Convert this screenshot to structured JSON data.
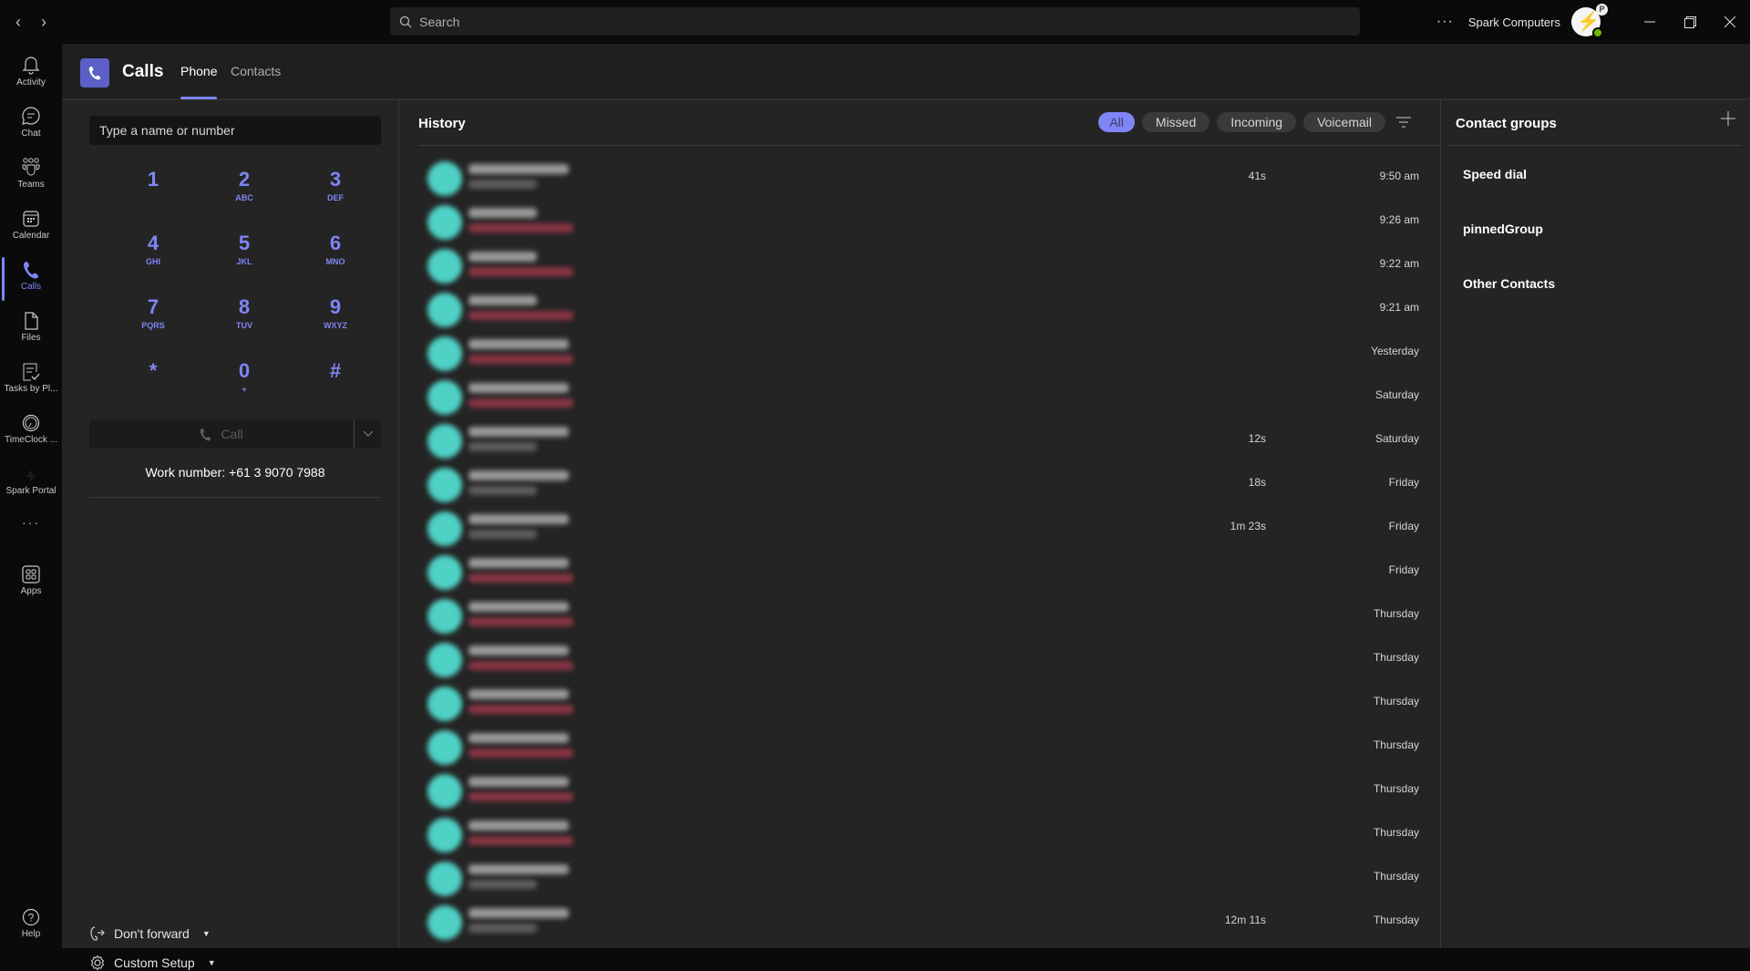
{
  "titlebar": {
    "search_placeholder": "Search",
    "more_label": "···",
    "org_name": "Spark Computers",
    "avatar_badge": "P",
    "icons": [
      "back-arrow-icon",
      "forward-arrow-icon",
      "search-icon",
      "more-icon",
      "minimize-icon",
      "restore-icon",
      "close-icon"
    ]
  },
  "rail": {
    "items": [
      {
        "label": "Activity",
        "icon": "bell-icon"
      },
      {
        "label": "Chat",
        "icon": "chat-icon"
      },
      {
        "label": "Teams",
        "icon": "teams-icon"
      },
      {
        "label": "Calendar",
        "icon": "calendar-icon"
      },
      {
        "label": "Calls",
        "icon": "phone-icon",
        "active": true
      },
      {
        "label": "Files",
        "icon": "file-icon"
      },
      {
        "label": "Tasks by Pl...",
        "icon": "tasks-icon"
      },
      {
        "label": "TimeClock ...",
        "icon": "clock-icon"
      },
      {
        "label": "Spark Portal",
        "icon": "bolt-icon"
      },
      {
        "label": "···",
        "icon": "more-apps-icon"
      },
      {
        "label": "Apps",
        "icon": "apps-icon"
      }
    ],
    "help_label": "Help"
  },
  "header": {
    "title": "Calls",
    "tabs": [
      {
        "label": "Phone",
        "active": true
      },
      {
        "label": "Contacts",
        "active": false
      }
    ]
  },
  "dialpad": {
    "input_placeholder": "Type a name or number",
    "keys": [
      {
        "digit": "1",
        "letters": ""
      },
      {
        "digit": "2",
        "letters": "ABC"
      },
      {
        "digit": "3",
        "letters": "DEF"
      },
      {
        "digit": "4",
        "letters": "GHI"
      },
      {
        "digit": "5",
        "letters": "JKL"
      },
      {
        "digit": "6",
        "letters": "MNO"
      },
      {
        "digit": "7",
        "letters": "PQRS"
      },
      {
        "digit": "8",
        "letters": "TUV"
      },
      {
        "digit": "9",
        "letters": "WXYZ"
      },
      {
        "digit": "*",
        "letters": ""
      },
      {
        "digit": "0",
        "letters": "+"
      },
      {
        "digit": "#",
        "letters": ""
      }
    ],
    "call_label": "Call",
    "work_number": "Work number: +61 3 9070 7988",
    "forward_label": "Don't forward",
    "setup_label": "Custom Setup"
  },
  "history": {
    "title": "History",
    "filters": [
      {
        "label": "All",
        "active": true
      },
      {
        "label": "Missed",
        "active": false
      },
      {
        "label": "Incoming",
        "active": false
      },
      {
        "label": "Voicemail",
        "active": false
      }
    ],
    "rows": [
      {
        "status": "normal",
        "duration": "41s",
        "time": "9:50 am"
      },
      {
        "status": "missed",
        "duration": "",
        "time": "9:26 am"
      },
      {
        "status": "missed",
        "duration": "",
        "time": "9:22 am"
      },
      {
        "status": "missed",
        "duration": "",
        "time": "9:21 am"
      },
      {
        "status": "missed",
        "duration": "",
        "time": "Yesterday"
      },
      {
        "status": "missed",
        "duration": "",
        "time": "Saturday"
      },
      {
        "status": "normal",
        "duration": "12s",
        "time": "Saturday"
      },
      {
        "status": "normal",
        "duration": "18s",
        "time": "Friday"
      },
      {
        "status": "normal",
        "duration": "1m 23s",
        "time": "Friday"
      },
      {
        "status": "missed",
        "duration": "",
        "time": "Friday"
      },
      {
        "status": "missed",
        "duration": "",
        "time": "Thursday"
      },
      {
        "status": "missed",
        "duration": "",
        "time": "Thursday"
      },
      {
        "status": "missed",
        "duration": "",
        "time": "Thursday"
      },
      {
        "status": "missed",
        "duration": "",
        "time": "Thursday"
      },
      {
        "status": "missed",
        "duration": "",
        "time": "Thursday"
      },
      {
        "status": "missed",
        "duration": "",
        "time": "Thursday"
      },
      {
        "status": "normal",
        "duration": "",
        "time": "Thursday"
      },
      {
        "status": "normal",
        "duration": "12m 11s",
        "time": "Thursday"
      }
    ]
  },
  "contact_groups": {
    "title": "Contact groups",
    "items": [
      "Speed dial",
      "pinnedGroup",
      "Other Contacts"
    ]
  },
  "colors": {
    "accent": "#7f85f5",
    "brand": "#5b5fc7",
    "avatar": "#4fd1c5",
    "missed": "#8a3544"
  }
}
